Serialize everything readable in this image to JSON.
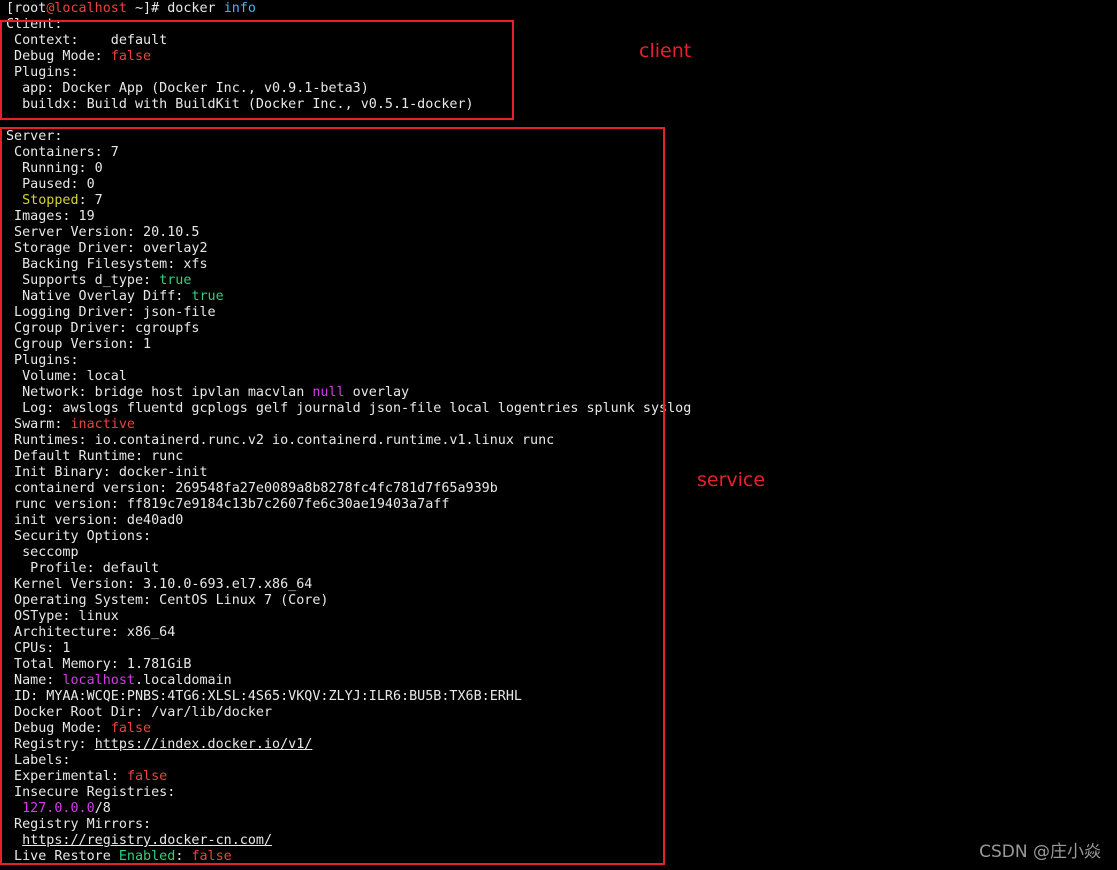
{
  "prompt": {
    "user": "root",
    "at": "@",
    "host": "localhost",
    "rest": " ~]# docker ",
    "arg": "info"
  },
  "lines": [
    [
      {
        "t": "Client:"
      }
    ],
    [
      {
        "t": " Context:    default"
      }
    ],
    [
      {
        "t": " Debug Mode: "
      },
      {
        "t": "false",
        "c": "red"
      }
    ],
    [
      {
        "t": " Plugins:"
      }
    ],
    [
      {
        "t": "  app: Docker App (Docker Inc., v0.9.1-beta3)"
      }
    ],
    [
      {
        "t": "  buildx: Build with BuildKit (Docker Inc., v0.5.1-docker)"
      }
    ],
    [],
    [
      {
        "t": "Server:"
      }
    ],
    [
      {
        "t": " Containers: 7"
      }
    ],
    [
      {
        "t": "  Running: 0"
      }
    ],
    [
      {
        "t": "  Paused: 0"
      }
    ],
    [
      {
        "t": "  "
      },
      {
        "t": "Stopped",
        "c": "yellow"
      },
      {
        "t": ": 7"
      }
    ],
    [
      {
        "t": " Images: 19"
      }
    ],
    [
      {
        "t": " Server Version: 20.10.5"
      }
    ],
    [
      {
        "t": " Storage Driver: overlay2"
      }
    ],
    [
      {
        "t": "  Backing Filesystem: xfs"
      }
    ],
    [
      {
        "t": "  Supports d_type: "
      },
      {
        "t": "true",
        "c": "green"
      }
    ],
    [
      {
        "t": "  Native Overlay Diff: "
      },
      {
        "t": "true",
        "c": "green"
      }
    ],
    [
      {
        "t": " Logging Driver: json-file"
      }
    ],
    [
      {
        "t": " Cgroup Driver: cgroupfs"
      }
    ],
    [
      {
        "t": " Cgroup Version: 1"
      }
    ],
    [
      {
        "t": " Plugins:"
      }
    ],
    [
      {
        "t": "  Volume: local"
      }
    ],
    [
      {
        "t": "  Network: bridge host ipvlan macvlan "
      },
      {
        "t": "null",
        "c": "magenta"
      },
      {
        "t": " overlay"
      }
    ],
    [
      {
        "t": "  Log: awslogs fluentd gcplogs gelf journald json-file local logentries splunk syslog"
      }
    ],
    [
      {
        "t": " Swarm: "
      },
      {
        "t": "inactive",
        "c": "red"
      }
    ],
    [
      {
        "t": " Runtimes: io.containerd.runc.v2 io.containerd.runtime.v1.linux runc"
      }
    ],
    [
      {
        "t": " Default Runtime: runc"
      }
    ],
    [
      {
        "t": " Init Binary: docker-init"
      }
    ],
    [
      {
        "t": " containerd version: 269548fa27e0089a8b8278fc4fc781d7f65a939b"
      }
    ],
    [
      {
        "t": " runc version: ff819c7e9184c13b7c2607fe6c30ae19403a7aff"
      }
    ],
    [
      {
        "t": " init version: de40ad0"
      }
    ],
    [
      {
        "t": " Security Options:"
      }
    ],
    [
      {
        "t": "  seccomp"
      }
    ],
    [
      {
        "t": "   Profile: default"
      }
    ],
    [
      {
        "t": " Kernel Version: 3.10.0-693.el7.x86_64"
      }
    ],
    [
      {
        "t": " Operating System: CentOS Linux 7 (Core)"
      }
    ],
    [
      {
        "t": " OSType: linux"
      }
    ],
    [
      {
        "t": " Architecture: x86_64"
      }
    ],
    [
      {
        "t": " CPUs: 1"
      }
    ],
    [
      {
        "t": " Total Memory: 1.781GiB"
      }
    ],
    [
      {
        "t": " Name: "
      },
      {
        "t": "localhost",
        "c": "magenta"
      },
      {
        "t": ".localdomain"
      }
    ],
    [
      {
        "t": " ID: MYAA:WCQE:PNBS:4TG6:XLSL:4S65:VKQV:ZLYJ:ILR6:BU5B:TX6B:ERHL"
      }
    ],
    [
      {
        "t": " Docker Root Dir: /var/lib/docker"
      }
    ],
    [
      {
        "t": " Debug Mode: "
      },
      {
        "t": "false",
        "c": "red"
      }
    ],
    [
      {
        "t": " Registry: "
      },
      {
        "t": "https://index.docker.io/v1/",
        "u": true
      }
    ],
    [
      {
        "t": " Labels:"
      }
    ],
    [
      {
        "t": " Experimental: "
      },
      {
        "t": "false",
        "c": "red"
      }
    ],
    [
      {
        "t": " Insecure Registries:"
      }
    ],
    [
      {
        "t": "  "
      },
      {
        "t": "127.0.0.0",
        "c": "magenta"
      },
      {
        "t": "/8"
      }
    ],
    [
      {
        "t": " Registry Mirrors:"
      }
    ],
    [
      {
        "t": "  "
      },
      {
        "t": "https://registry.docker-cn.com/",
        "u": true
      }
    ],
    [
      {
        "t": " Live Restore "
      },
      {
        "t": "Enabled",
        "c": "green"
      },
      {
        "t": ": "
      },
      {
        "t": "false",
        "c": "red"
      }
    ]
  ],
  "annotations": {
    "client": "client",
    "service": "service"
  },
  "watermark": "CSDN @庄小焱",
  "colors": {
    "background": "#000000",
    "text": "#e8e8e8",
    "red": "#e8453c",
    "green": "#2fd07a",
    "yellow": "#d8d23a",
    "magenta": "#d33ee4",
    "cyan": "#4fb3e8",
    "annotation": "#e8202a"
  }
}
